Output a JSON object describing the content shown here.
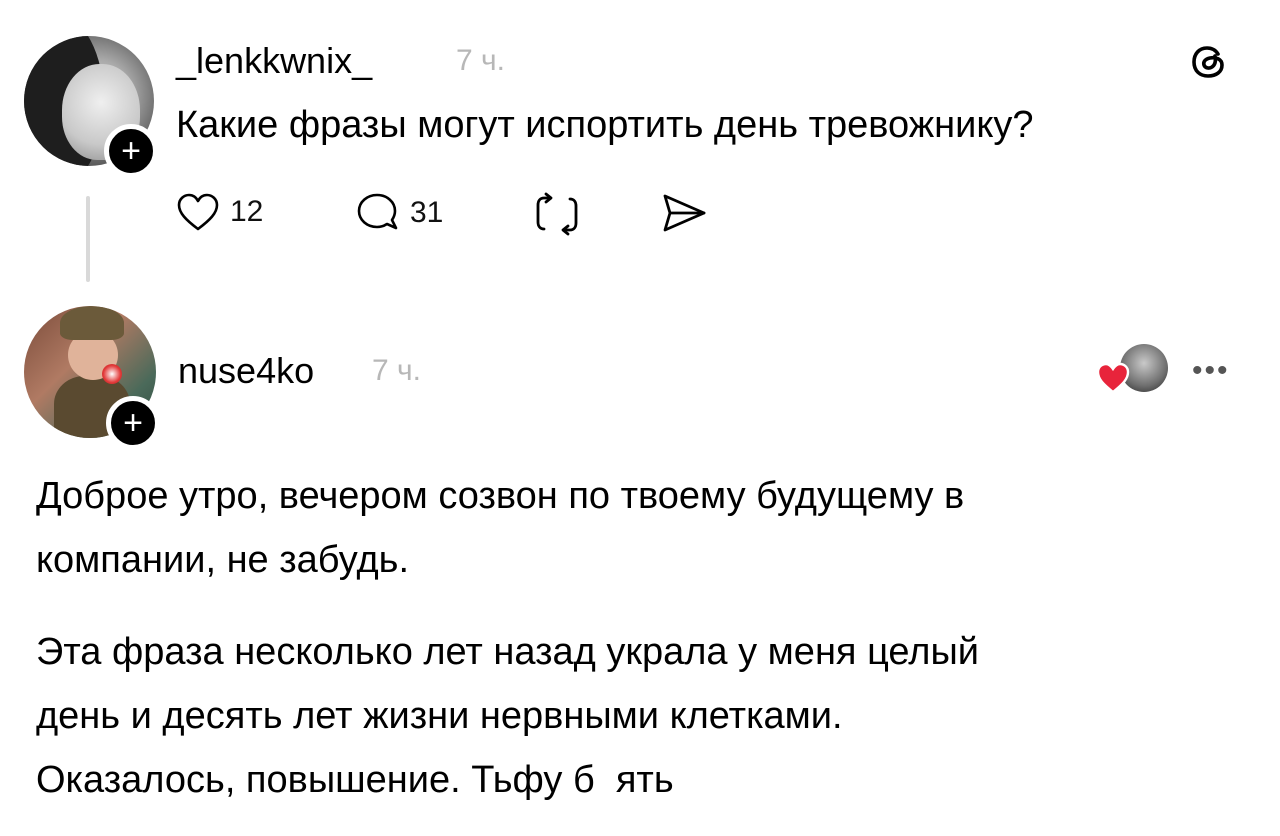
{
  "post": {
    "username": "_lenkkwnix_",
    "time": "7 ч.",
    "text": "Какие фразы могут испортить день тревожнику?",
    "likes": "12",
    "replies": "31",
    "follow_symbol": "+"
  },
  "reply": {
    "username": "nuse4ko",
    "time": "7 ч.",
    "follow_symbol": "+",
    "more": "•••",
    "paragraph1": [
      "Доброе утро, вечером созвон по твоему будущему в",
      "компании, не забудь."
    ],
    "paragraph2": [
      "Эта фраза несколько лет назад украла у меня целый",
      "день и десять лет жизни нервными клетками.",
      "Оказалось, повышение. Тьфу б  ять"
    ]
  },
  "icons": {
    "logo": "threads-logo-icon",
    "like": "heart-icon",
    "reply": "comment-bubble-icon",
    "repost": "repost-icon",
    "share": "send-icon",
    "liked_indicator": "red-heart-icon"
  },
  "colors": {
    "text": "#000000",
    "muted": "#b7b7b7",
    "liked_heart": "#e8243b",
    "thread_line": "#d9d9d9"
  }
}
